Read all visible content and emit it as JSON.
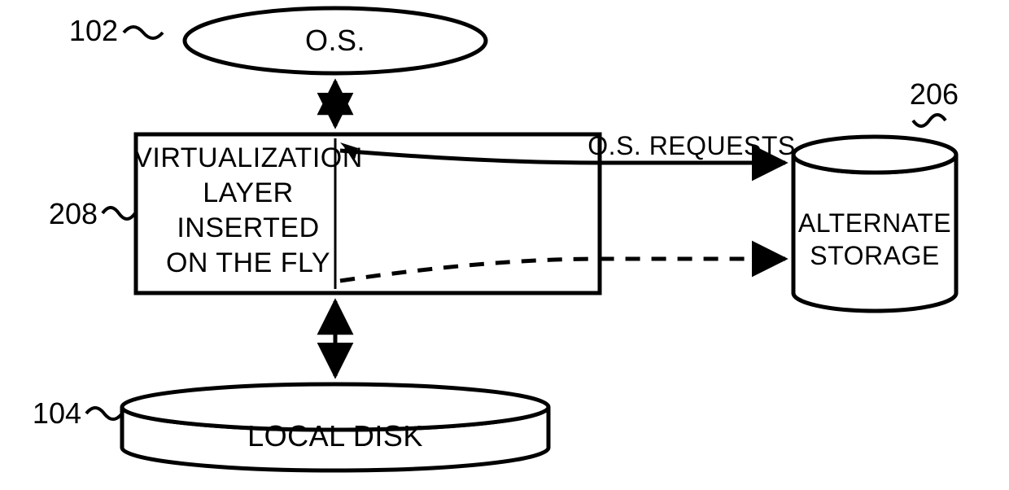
{
  "refs": {
    "os": "102",
    "layer": "208",
    "localDisk": "104",
    "altStorage": "206"
  },
  "nodes": {
    "os": "O.S.",
    "layer_l1": "VIRTUALIZATION",
    "layer_l2": "LAYER",
    "layer_l3": "INSERTED",
    "layer_l4": "ON THE FLY",
    "localDisk": "LOCAL DISK",
    "altStorage_l1": "ALTERNATE",
    "altStorage_l2": "STORAGE"
  },
  "edges": {
    "osRequests": "O.S. REQUESTS"
  }
}
